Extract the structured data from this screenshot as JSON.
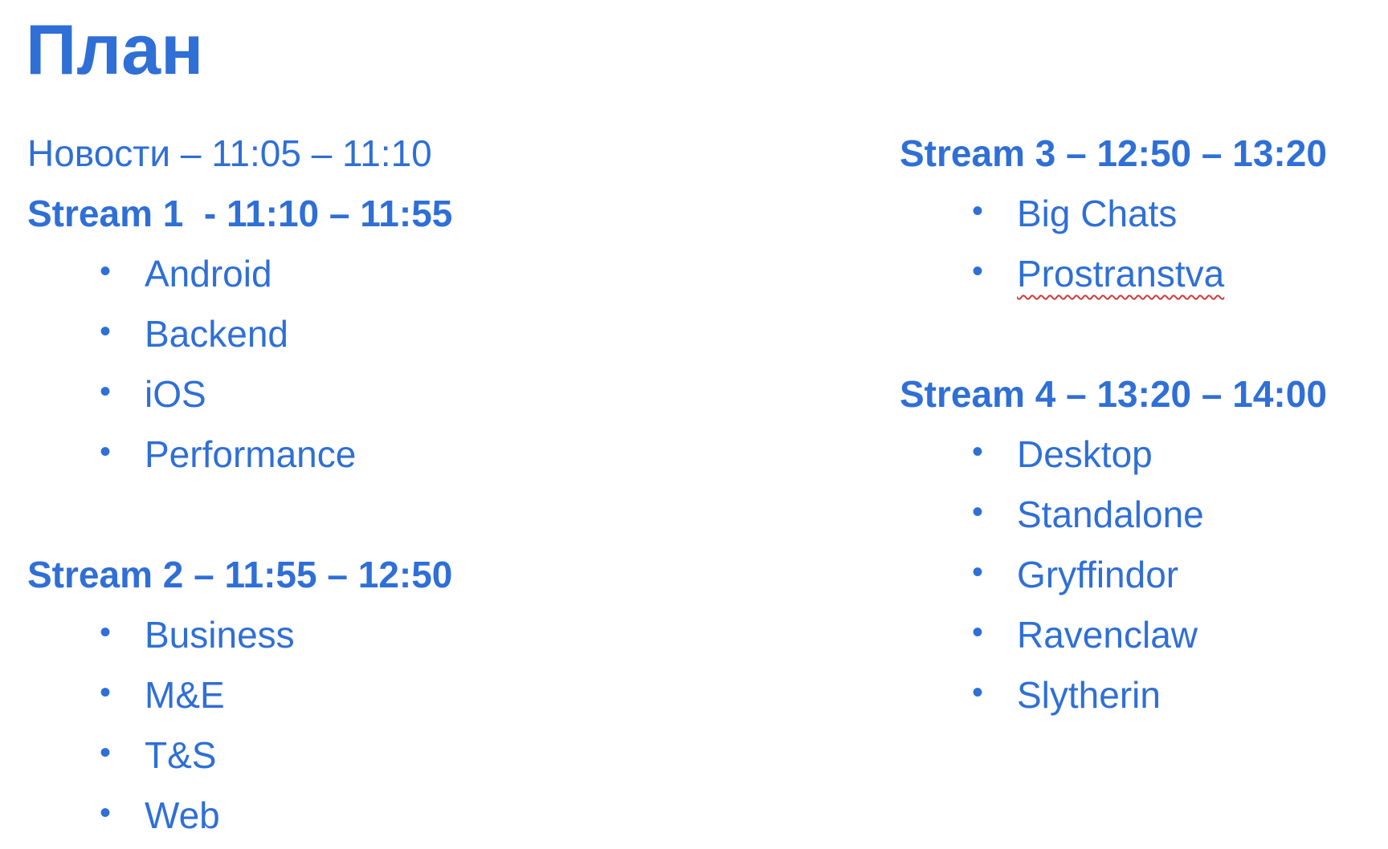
{
  "title": "План",
  "left": {
    "news": "Новости – 11:05 – 11:10",
    "stream1": {
      "heading": "Stream 1  - 11:10 – 11:55",
      "items": [
        "Android",
        "Backend",
        "iOS",
        "Performance"
      ]
    },
    "stream2": {
      "heading": "Stream 2 – 11:55 – 12:50",
      "items": [
        "Business",
        "M&E",
        "T&S",
        "Web"
      ]
    }
  },
  "right": {
    "stream3": {
      "heading": "Stream 3 – 12:50 – 13:20",
      "items": [
        "Big Chats",
        "Prostranstva"
      ]
    },
    "stream4": {
      "heading": "Stream 4 – 13:20 – 14:00",
      "items": [
        "Desktop",
        "Standalone",
        "Gryffindor",
        "Ravenclaw",
        "Slytherin"
      ]
    }
  },
  "bullet_glyph": "•",
  "colors": {
    "text": "#2f6fd6",
    "spellcheck": "#d23b3b"
  }
}
